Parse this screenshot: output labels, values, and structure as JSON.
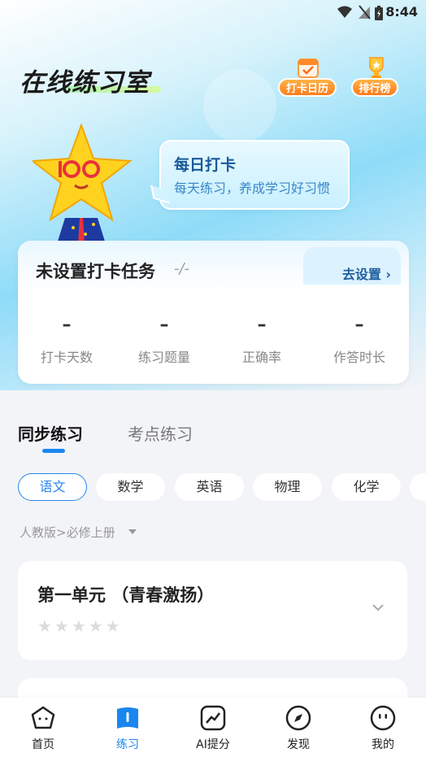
{
  "status": {
    "time": "8:44"
  },
  "header": {
    "title": "在线练习室",
    "calendar_label": "打卡日历",
    "rank_label": "排行榜"
  },
  "bubble": {
    "title": "每日打卡",
    "subtitle": "每天练习，养成学习好习惯"
  },
  "task": {
    "title": "未设置打卡任务",
    "suffix": "-/-",
    "set_label": "去设置 ›",
    "stats": [
      {
        "value": "–",
        "label": "打卡天数"
      },
      {
        "value": "–",
        "label": "练习题量"
      },
      {
        "value": "–",
        "label": "正确率"
      },
      {
        "value": "–",
        "label": "作答时长"
      }
    ]
  },
  "tabs": {
    "sync": "同步练习",
    "points": "考点练习"
  },
  "subjects": [
    "语文",
    "数学",
    "英语",
    "物理",
    "化学"
  ],
  "edition": "人教版>必修上册",
  "unit": {
    "title": "第一单元 （青春激扬）",
    "stars": "★★★★★",
    "rating": 0
  },
  "nav": {
    "home": "首页",
    "practice": "练习",
    "ai": "AI提分",
    "discover": "发现",
    "mine": "我的"
  },
  "colors": {
    "accent": "#1a86f0",
    "orange": "#ff7a1a"
  }
}
